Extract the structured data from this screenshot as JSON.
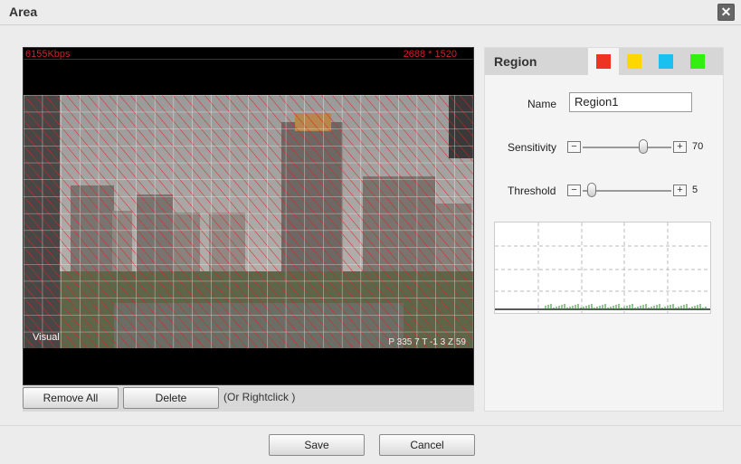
{
  "dialog": {
    "title": "Area",
    "close_icon": "close-icon"
  },
  "video": {
    "bitrate": "6155Kbps",
    "resolution": "2688 * 1520",
    "channel_label": "Visual",
    "ptz_readout": "P 335 7 T -1 3 Z 59"
  },
  "buttons": {
    "remove_all": "Remove All",
    "delete": "Delete",
    "rightclick_hint": "(Or Rightclick )",
    "save": "Save",
    "cancel": "Cancel"
  },
  "region_panel": {
    "title": "Region",
    "color_tabs": [
      {
        "color": "#ee3322",
        "active": true
      },
      {
        "color": "#ffd700",
        "active": false
      },
      {
        "color": "#19c0f0",
        "active": false
      },
      {
        "color": "#33ee11",
        "active": false
      }
    ],
    "name_label": "Name",
    "name_value": "Region1",
    "sensitivity_label": "Sensitivity",
    "sensitivity_value": "70",
    "threshold_label": "Threshold",
    "threshold_value": "5"
  },
  "colors": {
    "grid_line": "#ffffff",
    "area_hatch": "#e02020",
    "graph_bars": "#2a8a2a"
  }
}
